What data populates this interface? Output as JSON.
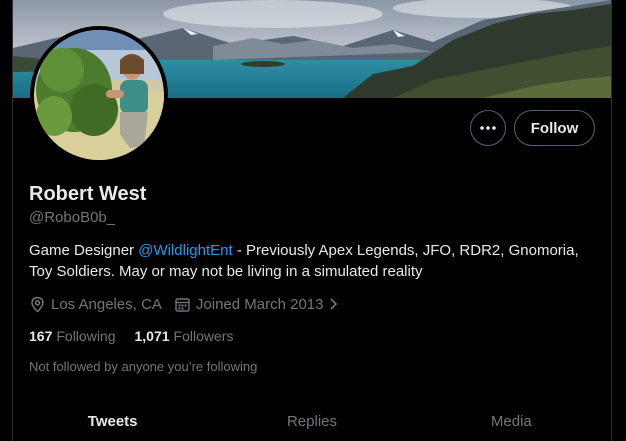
{
  "profile": {
    "name": "Robert West",
    "handle": "@RoboB0b_",
    "bio": {
      "before": "Game Designer ",
      "mention": "@WildlightEnt",
      "after": " - Previously Apex Legends, JFO, RDR2, Gnomoria, Toy Soldiers. May or may not be living in a simulated reality"
    },
    "location": "Los Angeles, CA",
    "joined": "Joined March 2013",
    "following_count": "167",
    "following_label": "Following",
    "followers_count": "1,071",
    "followers_label": "Followers",
    "not_followed_text": "Not followed by anyone you’re following"
  },
  "actions": {
    "more_icon": "more-horizontal-icon",
    "follow_label": "Follow"
  },
  "tabs": [
    {
      "label": "Tweets",
      "active": true
    },
    {
      "label": "Replies",
      "active": false
    },
    {
      "label": "Media",
      "active": false
    }
  ],
  "colors": {
    "background": "#000000",
    "text_primary": "#e7e9ea",
    "text_secondary": "#71767b",
    "accent": "#1d9bf0",
    "border": "#2f3336"
  }
}
